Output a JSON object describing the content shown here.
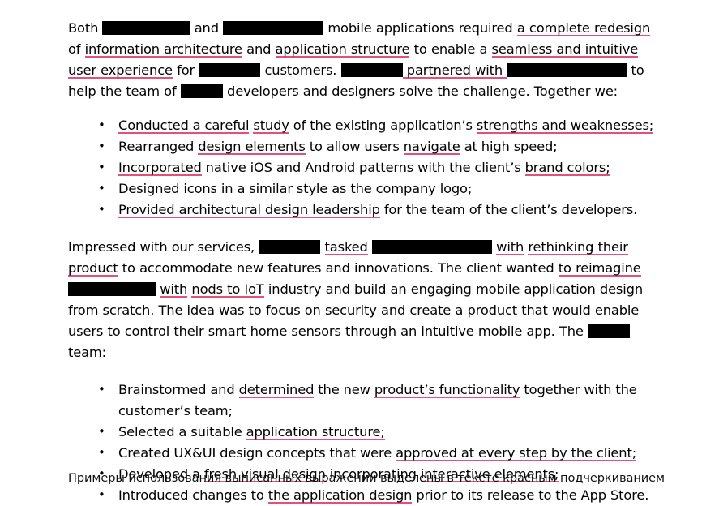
{
  "document": {
    "paragraph1": {
      "segments": [
        {
          "type": "text",
          "value": "Both "
        },
        {
          "type": "redaction",
          "size": "r-l"
        },
        {
          "type": "text",
          "value": " and "
        },
        {
          "type": "redaction",
          "size": "r-xl"
        },
        {
          "type": "text",
          "value": " mobile applications required "
        },
        {
          "type": "underlined",
          "value": "a complete redesign"
        },
        {
          "type": "text",
          "value": " of "
        },
        {
          "type": "underlined",
          "value": "information architecture"
        },
        {
          "type": "text",
          "value": " and "
        },
        {
          "type": "underlined",
          "value": "application structure"
        },
        {
          "type": "text",
          "value": " to enable a "
        },
        {
          "type": "underlined",
          "value": "seamless and intuitive user experience"
        },
        {
          "type": "text",
          "value": " for "
        },
        {
          "type": "redaction",
          "size": "r-m"
        },
        {
          "type": "text",
          "value": " customers. "
        },
        {
          "type": "redaction",
          "size": "r-m"
        },
        {
          "type": "underlined",
          "value": " partnered with "
        },
        {
          "type": "redaction",
          "size": "r-xxl"
        },
        {
          "type": "text",
          "value": " to help the team of "
        },
        {
          "type": "redaction",
          "size": "r-s"
        },
        {
          "type": "text",
          "value": " developers and designers solve the challenge. Together we:"
        }
      ],
      "plain_text": "Both [REDACTED] and [REDACTED] mobile applications required a complete redesign of information architecture and application structure to enable a seamless and intuitive user experience for [REDACTED] customers. [REDACTED] partnered with [REDACTED] to help the team of [REDACTED] developers and designers solve the challenge. Together we:"
    },
    "bullets1": [
      {
        "segments": [
          {
            "type": "underlined",
            "value": "Conducted a careful"
          },
          {
            "type": "text",
            "value": " "
          },
          {
            "type": "underlined",
            "value": "study"
          },
          {
            "type": "text",
            "value": " of the existing application’s "
          },
          {
            "type": "underlined",
            "value": "strengths and weaknesses;"
          }
        ],
        "plain_text": "Conducted a careful study of the existing application’s strengths and weaknesses;"
      },
      {
        "segments": [
          {
            "type": "text",
            "value": "Rearranged "
          },
          {
            "type": "underlined",
            "value": "design elements"
          },
          {
            "type": "text",
            "value": " to allow users "
          },
          {
            "type": "underlined",
            "value": "navigate"
          },
          {
            "type": "text",
            "value": " at high speed;"
          }
        ],
        "plain_text": "Rearranged design elements to allow users navigate at high speed;"
      },
      {
        "segments": [
          {
            "type": "underlined",
            "value": "Incorporated"
          },
          {
            "type": "text",
            "value": " native iOS and Android patterns with the client’s "
          },
          {
            "type": "underlined",
            "value": "brand colors;"
          }
        ],
        "plain_text": "Incorporated native iOS and Android patterns with the client’s brand colors;"
      },
      {
        "segments": [
          {
            "type": "text",
            "value": "Designed icons in a similar style as the company logo;"
          }
        ],
        "plain_text": "Designed icons in a similar style as the company logo;"
      },
      {
        "segments": [
          {
            "type": "underlined",
            "value": "Provided architectural design leadership"
          },
          {
            "type": "text",
            "value": " for the team of the client’s developers."
          }
        ],
        "plain_text": "Provided architectural design leadership for the team of the client’s developers."
      }
    ],
    "paragraph2": {
      "segments": [
        {
          "type": "text",
          "value": "Impressed with our services, "
        },
        {
          "type": "redaction",
          "size": "r-m"
        },
        {
          "type": "text",
          "value": " "
        },
        {
          "type": "underlined",
          "value": "tasked"
        },
        {
          "type": "text",
          "value": " "
        },
        {
          "type": "redaction",
          "size": "r-xxl"
        },
        {
          "type": "text",
          "value": " "
        },
        {
          "type": "underlined",
          "value": "with"
        },
        {
          "type": "text",
          "value": " "
        },
        {
          "type": "underlined",
          "value": "rethinking their product"
        },
        {
          "type": "text",
          "value": " to accommodate new features and innovations. The client wanted "
        },
        {
          "type": "underlined",
          "value": "to reimagine"
        },
        {
          "type": "text",
          "value": " "
        },
        {
          "type": "redaction",
          "size": "r-l"
        },
        {
          "type": "text",
          "value": " "
        },
        {
          "type": "underlined",
          "value": "with"
        },
        {
          "type": "text",
          "value": " "
        },
        {
          "type": "underlined",
          "value": "nods to IoT"
        },
        {
          "type": "text",
          "value": " industry and build an engaging mobile application design from scratch. The idea was to focus on security and create a product that would enable users to control their smart home sensors through an intuitive mobile app. The "
        },
        {
          "type": "redaction",
          "size": "r-s"
        },
        {
          "type": "text",
          "value": " team:"
        }
      ],
      "plain_text": "Impressed with our services, [REDACTED] tasked [REDACTED] with rethinking their product to accommodate new features and innovations. The client wanted to reimagine [REDACTED] with nods to IoT industry and build an engaging mobile application design from scratch. The idea was to focus on security and create a product that would enable users to control their smart home sensors through an intuitive mobile app. The [REDACTED] team:"
    },
    "bullets2": [
      {
        "segments": [
          {
            "type": "text",
            "value": "Brainstormed and "
          },
          {
            "type": "underlined",
            "value": "determined"
          },
          {
            "type": "text",
            "value": " the new "
          },
          {
            "type": "underlined",
            "value": "product’s functionality"
          },
          {
            "type": "text",
            "value": " together with the customer’s team;"
          }
        ],
        "plain_text": "Brainstormed and determined the new product’s functionality together with the customer’s team;"
      },
      {
        "segments": [
          {
            "type": "text",
            "value": "Selected a suitable "
          },
          {
            "type": "underlined",
            "value": "application structure;"
          }
        ],
        "plain_text": "Selected a suitable application structure;"
      },
      {
        "segments": [
          {
            "type": "text",
            "value": "Created UX&UI design concepts that were "
          },
          {
            "type": "underlined",
            "value": "approved at every step by the client;"
          }
        ],
        "plain_text": "Created UX&UI design concepts that were approved at every step by the client;"
      },
      {
        "segments": [
          {
            "type": "text",
            "value": "Developed a "
          },
          {
            "type": "underlined",
            "value": "fresh visual design"
          },
          {
            "type": "text",
            "value": " incorporating "
          },
          {
            "type": "underlined",
            "value": "interactive elements;"
          }
        ],
        "plain_text": "Developed a fresh visual design incorporating interactive elements;"
      },
      {
        "segments": [
          {
            "type": "text",
            "value": "Introduced changes to "
          },
          {
            "type": "underlined",
            "value": "the application design"
          },
          {
            "type": "text",
            "value": " prior to its release to the App Store."
          }
        ],
        "plain_text": "Introduced changes to the application design prior to its release to the App Store."
      }
    ],
    "footer_note": "Примеры использования выписанных выражений выделены в тексте красным подчеркиванием"
  },
  "colors": {
    "underline": "#e3507b",
    "text": "#000000",
    "redaction": "#000000",
    "background": "#ffffff"
  }
}
